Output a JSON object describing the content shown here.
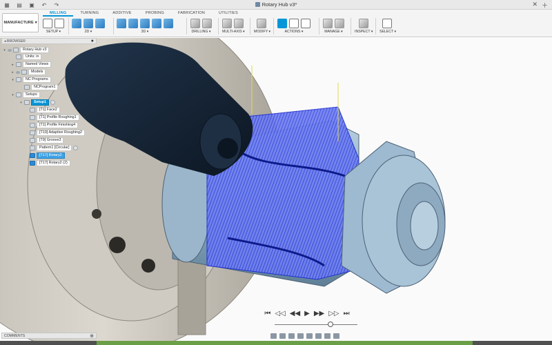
{
  "document": {
    "title": "Rotary Hub v3*"
  },
  "ribbon": {
    "workspace": "MANUFACTURE",
    "tabs": [
      "MILLING",
      "TURNING",
      "ADDITIVE",
      "PROBING",
      "FABRICATION",
      "UTILITIES"
    ],
    "active_tab": "MILLING",
    "groups": {
      "setup": "SETUP ▾",
      "g2d": "2D ▾",
      "g3d": "3D ▾",
      "drilling": "DRILLING ▾",
      "multiaxis": "MULTI-AXIS ▾",
      "modify": "MODIFY ▾",
      "actions": "ACTIONS ▾",
      "manage": "MANAGE ▾",
      "inspect": "INSPECT ▾",
      "select": "SELECT ▾"
    }
  },
  "browser": {
    "header": "BROWSER",
    "items": [
      {
        "label": "Rotary Hub v3"
      },
      {
        "label": "Units: in"
      },
      {
        "label": "Named Views"
      },
      {
        "label": "Models"
      },
      {
        "label": "NC Programs"
      },
      {
        "label": "NCProgram1"
      },
      {
        "label": "Setups"
      },
      {
        "label": "Setup1"
      },
      {
        "label": "[T1] Face2"
      },
      {
        "label": "[T1] Profile Roughing1"
      },
      {
        "label": "[T1] Profile Finishing4"
      },
      {
        "label": "[T10] Adaptive Roughing2"
      },
      {
        "label": "[T9] Groove3"
      },
      {
        "label": "Pattern1 [Circular]"
      },
      {
        "label": "[T17] Rotary2"
      },
      {
        "label": "[T17] Rotary2 (2)"
      }
    ]
  },
  "comments": {
    "label": "COMMENTS"
  },
  "colors": {
    "accent": "#0696d7",
    "toolpath": "#2b3fe0",
    "part": "#8fb0c8"
  }
}
